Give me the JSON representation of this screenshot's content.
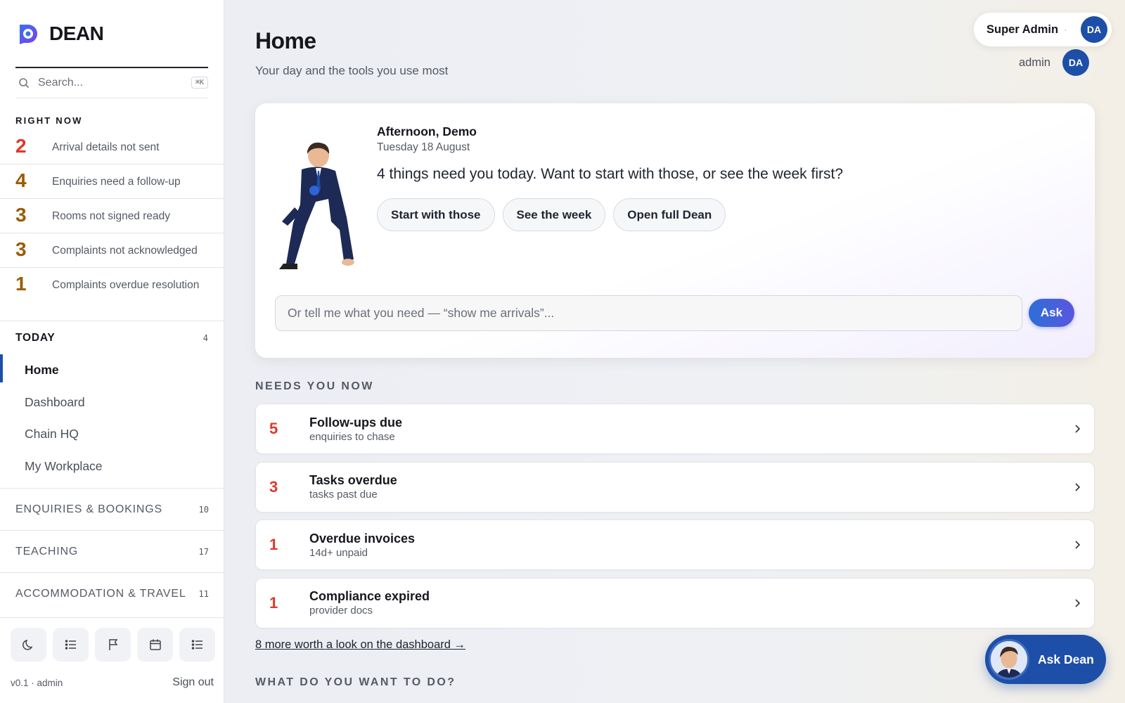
{
  "brand": {
    "name": "DEAN"
  },
  "search": {
    "placeholder": "Search...",
    "shortcut": "⌘K"
  },
  "right_now": {
    "title": "RIGHT NOW",
    "items": [
      {
        "count": "2",
        "label": "Arrival details not sent",
        "tone": "red"
      },
      {
        "count": "4",
        "label": "Enquiries need a follow-up",
        "tone": "amber"
      },
      {
        "count": "3",
        "label": "Rooms not signed ready",
        "tone": "amber"
      },
      {
        "count": "3",
        "label": "Complaints not acknowledged",
        "tone": "amber"
      },
      {
        "count": "1",
        "label": "Complaints overdue resolution",
        "tone": "amber"
      }
    ]
  },
  "today": {
    "title": "TODAY",
    "count": "4",
    "items": [
      "Home",
      "Dashboard",
      "Chain HQ",
      "My Workplace"
    ],
    "active": "Home"
  },
  "sections": [
    {
      "title": "ENQUIRIES & BOOKINGS",
      "count": "10"
    },
    {
      "title": "TEACHING",
      "count": "17"
    },
    {
      "title": "ACCOMMODATION & TRAVEL",
      "count": "11"
    }
  ],
  "tools": [
    "moon-icon",
    "list-icon",
    "flag-icon",
    "calendar-icon",
    "list-icon"
  ],
  "footer": {
    "version": "v0.1 · admin",
    "signout": "Sign out"
  },
  "header": {
    "title": "Home",
    "subtitle": "Your day and the tools you use most"
  },
  "user": {
    "primary_name": "Super Admin",
    "primary_initials": "DA",
    "secondary_name": "admin",
    "secondary_initials": "DA"
  },
  "greeting": {
    "title": "Afternoon, Demo",
    "date": "Tuesday 18 August",
    "message": "4 things need you today. Want to start with those, or see the week first?",
    "buttons": [
      "Start with those",
      "See the week",
      "Open full Dean"
    ],
    "input_placeholder": "Or tell me what you need — “show me arrivals”...",
    "ask_label": "Ask"
  },
  "needs": {
    "title": "NEEDS YOU NOW",
    "items": [
      {
        "count": "5",
        "title": "Follow-ups due",
        "subtitle": "enquiries to chase"
      },
      {
        "count": "3",
        "title": "Tasks overdue",
        "subtitle": "tasks past due"
      },
      {
        "count": "1",
        "title": "Overdue invoices",
        "subtitle": "14d+ unpaid"
      },
      {
        "count": "1",
        "title": "Compliance expired",
        "subtitle": "provider docs"
      }
    ],
    "more_link": "8 more worth a look on the dashboard →"
  },
  "what_to_do": {
    "title": "WHAT DO YOU WANT TO DO?"
  },
  "ask_dean": {
    "label": "Ask Dean"
  },
  "colors": {
    "accent": "#1d4fa8",
    "alert": "#e0392b",
    "amber": "#9b5b07"
  }
}
